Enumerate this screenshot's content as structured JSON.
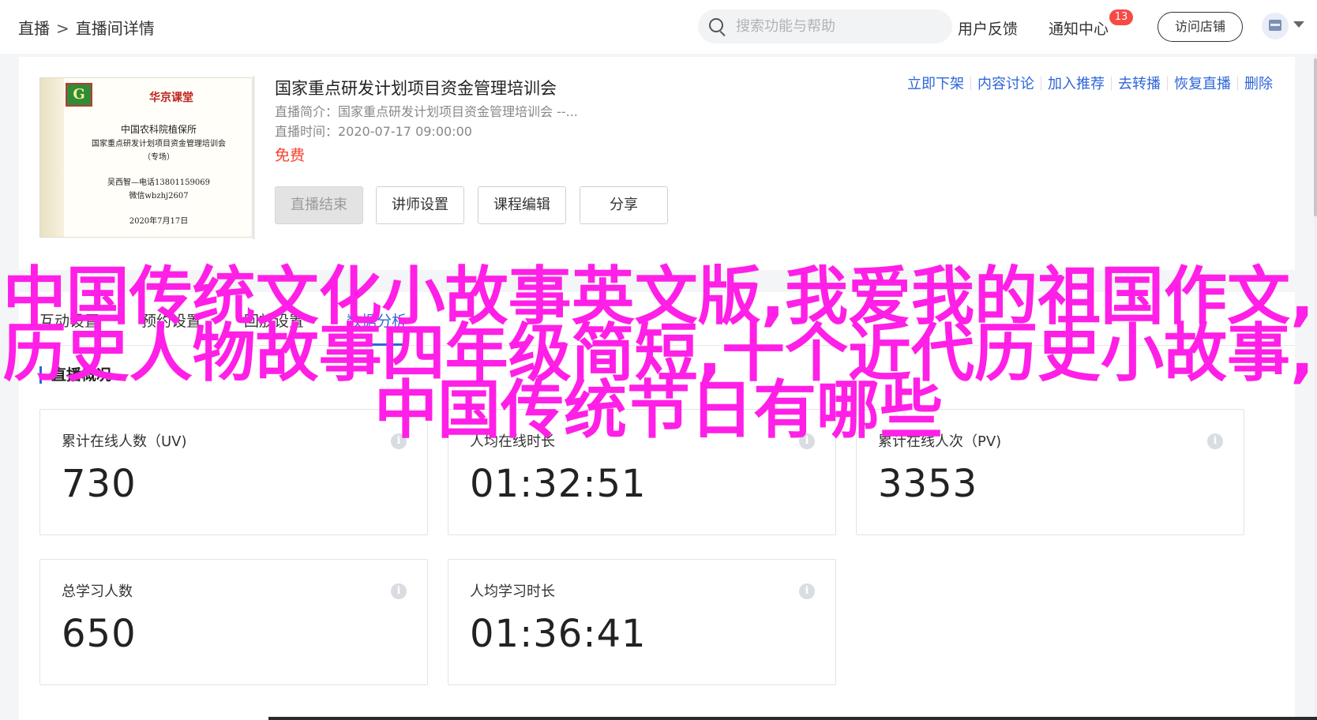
{
  "breadcrumb": {
    "root": "直播",
    "separator": ">",
    "current": "直播间详情"
  },
  "search": {
    "placeholder": "搜索功能与帮助"
  },
  "header": {
    "feedback": "用户反馈",
    "notifications": "通知中心",
    "notification_count": "13",
    "visit_store": "访问店铺"
  },
  "cover": {
    "logo_letter": "G",
    "brand": "华京课堂",
    "org": "中国农科院植保所",
    "course": "国家重点研发计划项目资金管理培训会",
    "tag": "（专场）",
    "contact": "吴西智—电话13801159069",
    "wechat": "微信wbzhj2607",
    "date": "2020年7月17日"
  },
  "live": {
    "title": "国家重点研发计划项目资金管理培训会",
    "intro": "直播简介：国家重点研发计划项目资金管理培训会 --...",
    "time": "直播时间：2020-07-17 09:00:00",
    "price": "免费"
  },
  "buttons": {
    "end_live": "直播结束",
    "lecturer": "讲师设置",
    "course_edit": "课程编辑",
    "share": "分享"
  },
  "ops": [
    "立即下架",
    "内容讨论",
    "加入推荐",
    "去转播",
    "恢复直播",
    "删除"
  ],
  "tabs": [
    "互动设置",
    "预约设置",
    "回放设置",
    "数据分析"
  ],
  "section": {
    "title": "直播概况"
  },
  "stats": [
    {
      "label": "累计在线人数（UV)",
      "value": "730"
    },
    {
      "label": "人均在线时长",
      "value": "01:32:51"
    },
    {
      "label": "累计在线人次（PV)",
      "value": "3353"
    },
    {
      "label": "总学习人数",
      "value": "650"
    },
    {
      "label": "人均学习时长",
      "value": "01:36:41"
    }
  ],
  "overlay": {
    "line1": "中国传统文化小故事英文版,我爱我的祖国作文,",
    "line2": "历史人物故事四年级简短,十个近代历史小故事,",
    "line3": "中国传统节日有哪些"
  },
  "colors": {
    "accent": "#2e66d8",
    "price": "#f5412d",
    "overlay": "#ff1fe6",
    "badge": "#f54a45"
  }
}
